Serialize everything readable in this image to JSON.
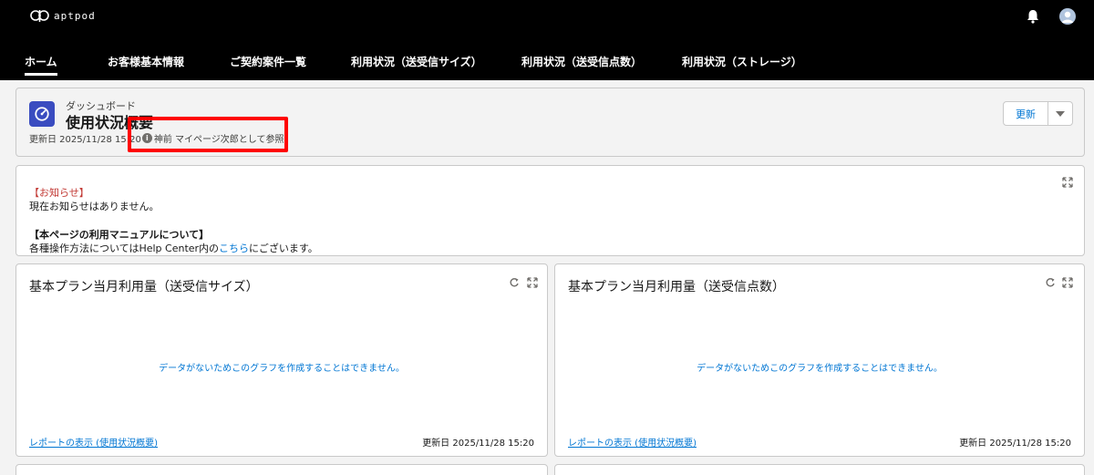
{
  "header": {
    "logo_text": "aptpod",
    "icons": {
      "notifications": "bell-icon",
      "user": "avatar"
    }
  },
  "nav": {
    "items": [
      {
        "label": "ホーム",
        "active": true
      },
      {
        "label": "お客様基本情報"
      },
      {
        "label": "ご契約案件一覧"
      },
      {
        "label": "利用状況（送受信サイズ）"
      },
      {
        "label": "利用状況（送受信点数）"
      },
      {
        "label": "利用状況（ストレージ）"
      }
    ]
  },
  "dashboard": {
    "subtitle": "ダッシュボード",
    "title": "使用状況概要",
    "updated": "更新日 2025/11/28 15:20",
    "viewing_as": "神前 マイページ次郎として参照",
    "refresh_label": "更新"
  },
  "notice": {
    "heading": "【お知らせ】",
    "body": "現在お知らせはありません。",
    "manual_heading": "【本ページの利用マニュアルについて】",
    "manual_prefix": "各種操作方法についてはHelp Center内の",
    "manual_link": "こちら",
    "manual_suffix": "にございます。"
  },
  "cards": [
    {
      "title": "基本プラン当月利用量（送受信サイズ）",
      "empty_message": "データがないためこのグラフを作成することはできません。",
      "report_link": "レポートの表示 (使用状況概要)",
      "updated": "更新日 2025/11/28 15:20"
    },
    {
      "title": "基本プラン当月利用量（送受信点数）",
      "empty_message": "データがないためこのグラフを作成することはできません。",
      "report_link": "レポートの表示 (使用状況概要)",
      "updated": "更新日 2025/11/28 15:20"
    }
  ],
  "colors": {
    "topbar": "#000000",
    "accent": "#0176d3",
    "notice_red": "#c23934",
    "dashboard_icon": "#3a4cc0",
    "highlight": "#ff0000"
  }
}
